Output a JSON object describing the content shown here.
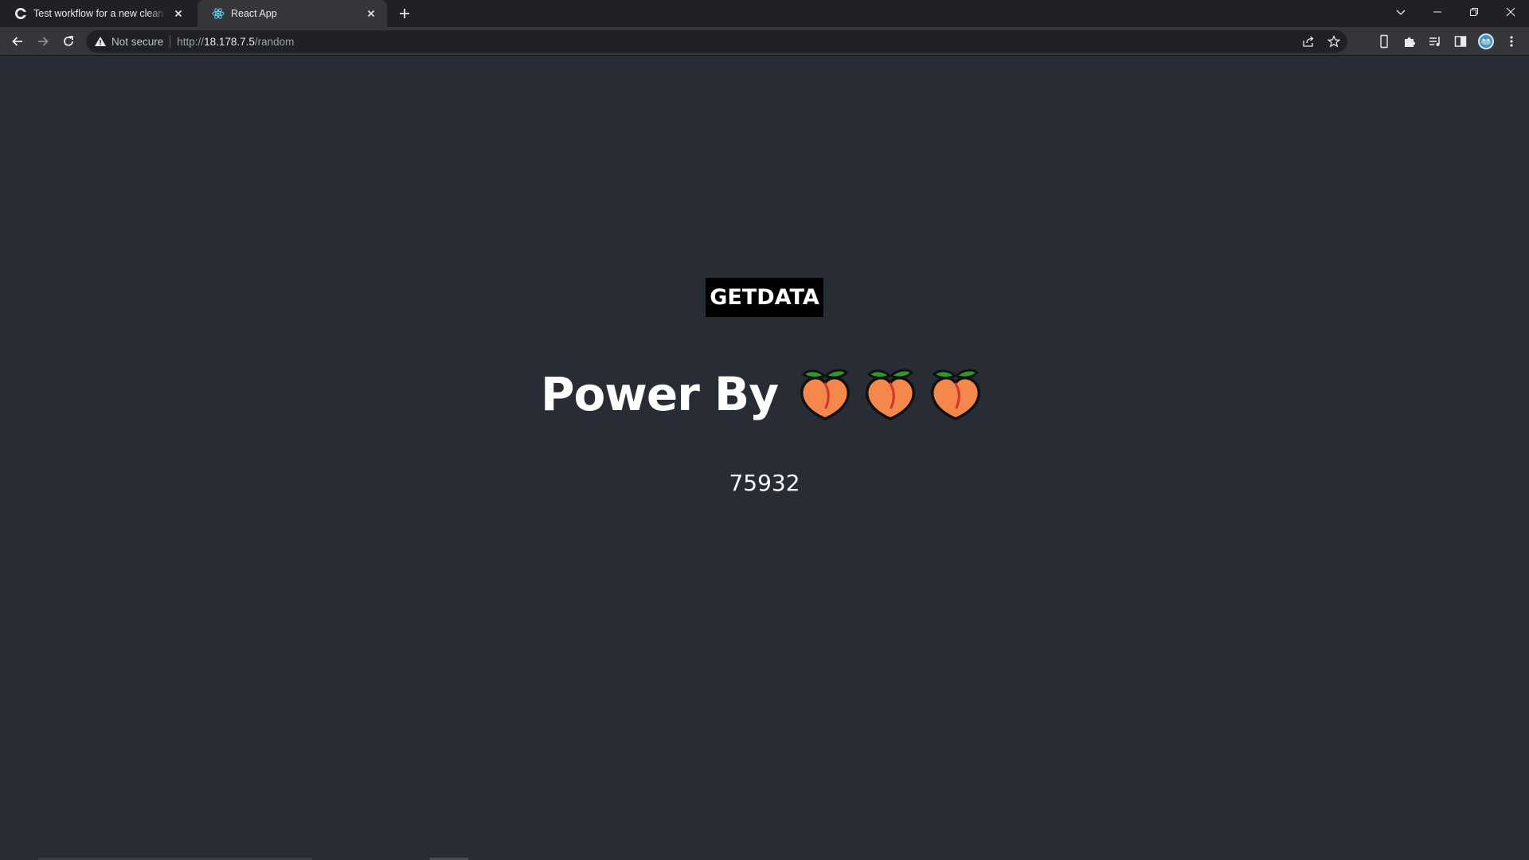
{
  "browser": {
    "tabs": [
      {
        "title": "Test workflow for a new clean VP",
        "favicon": "github-icon",
        "active": false
      },
      {
        "title": "React App",
        "favicon": "react-icon",
        "active": true
      }
    ],
    "address_bar": {
      "security_label": "Not secure",
      "url_scheme": "http://",
      "url_host": "18.178.7.5",
      "url_path": "/random"
    }
  },
  "page": {
    "button_label": "GETDATA",
    "power_text": "Power By",
    "peach_icons": [
      "peach-icon",
      "peach-icon",
      "peach-icon"
    ],
    "random_number": "75932"
  },
  "colors": {
    "page_background": "#282c34",
    "button_background": "#000000",
    "text": "#ffffff"
  }
}
